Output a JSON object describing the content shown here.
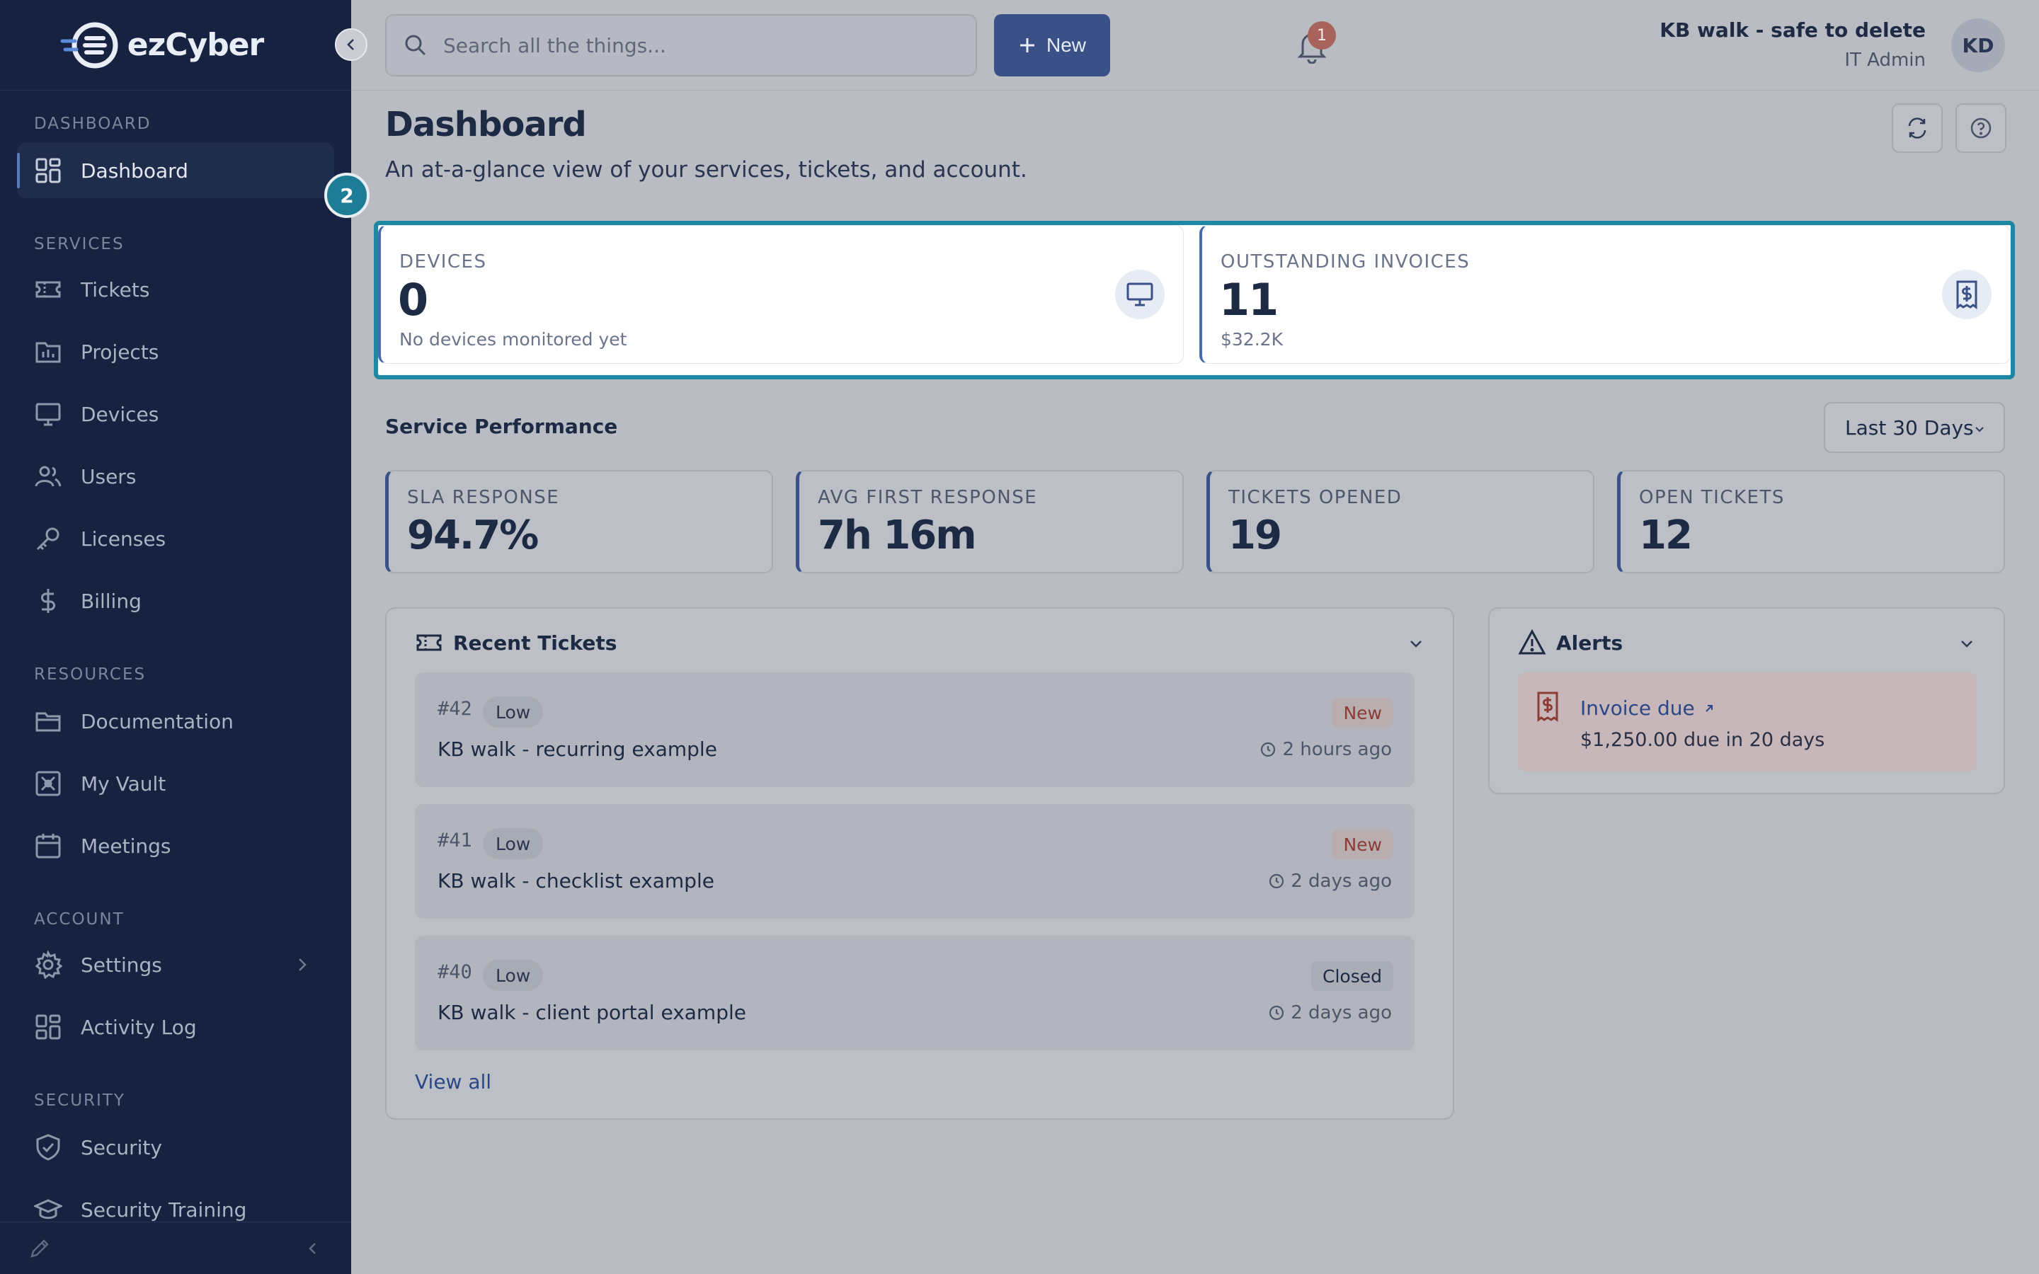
{
  "brand": {
    "logo_text": "ezCyber"
  },
  "sidebar": {
    "sections": [
      {
        "label": "DASHBOARD"
      },
      {
        "label": "SERVICES"
      },
      {
        "label": "RESOURCES"
      },
      {
        "label": "ACCOUNT"
      },
      {
        "label": "SECURITY"
      }
    ],
    "items": [
      {
        "label": "Dashboard",
        "icon": "dashboard-icon",
        "active": true
      },
      {
        "label": "Tickets",
        "icon": "ticket-icon"
      },
      {
        "label": "Projects",
        "icon": "projects-icon"
      },
      {
        "label": "Devices",
        "icon": "monitor-icon"
      },
      {
        "label": "Users",
        "icon": "users-icon"
      },
      {
        "label": "Licenses",
        "icon": "key-icon"
      },
      {
        "label": "Billing",
        "icon": "dollar-icon"
      },
      {
        "label": "Documentation",
        "icon": "folder-icon"
      },
      {
        "label": "My Vault",
        "icon": "vault-icon"
      },
      {
        "label": "Meetings",
        "icon": "calendar-icon"
      },
      {
        "label": "Settings",
        "icon": "gear-icon"
      },
      {
        "label": "Activity Log",
        "icon": "activity-icon"
      },
      {
        "label": "Security",
        "icon": "shield-icon"
      },
      {
        "label": "Security Training",
        "icon": "graduation-cap-icon"
      }
    ]
  },
  "topbar": {
    "search_placeholder": "Search all the things...",
    "new_label": "New",
    "notification_count": "1",
    "user_name": "KB walk - safe to delete",
    "user_role": "IT Admin",
    "avatar_initials": "KD"
  },
  "page": {
    "title": "Dashboard",
    "subtitle": "An at-a-glance view of your services, tickets, and account.",
    "step_badge": "2"
  },
  "kpis": [
    {
      "label": "DEVICES",
      "value": "0",
      "note": "No devices monitored yet",
      "icon": "monitor-icon"
    },
    {
      "label": "OUTSTANDING INVOICES",
      "value": "11",
      "note": "$32.2K",
      "icon": "invoice-icon"
    }
  ],
  "performance": {
    "title": "Service Performance",
    "range": "Last 30 Days",
    "metrics": [
      {
        "label": "SLA RESPONSE",
        "value": "94.7%"
      },
      {
        "label": "AVG FIRST RESPONSE",
        "value": "7h 16m"
      },
      {
        "label": "TICKETS OPENED",
        "value": "19"
      },
      {
        "label": "OPEN TICKETS",
        "value": "12"
      }
    ]
  },
  "recent_tickets": {
    "title": "Recent Tickets",
    "items": [
      {
        "number": "#42",
        "priority": "Low",
        "title": "KB walk - recurring example",
        "status": "New",
        "time": "2 hours ago"
      },
      {
        "number": "#41",
        "priority": "Low",
        "title": "KB walk - checklist example",
        "status": "New",
        "time": "2 days ago"
      },
      {
        "number": "#40",
        "priority": "Low",
        "title": "KB walk - client portal example",
        "status": "Closed",
        "time": "2 days ago"
      }
    ],
    "view_all": "View all"
  },
  "alerts": {
    "title": "Alerts",
    "items": [
      {
        "title": "Invoice due",
        "detail": "$1,250.00 due in 20 days"
      }
    ]
  },
  "colors": {
    "sidebar_bg": "#16223f",
    "accent": "#3a5188",
    "highlight": "#1e87a3",
    "status_new": "#8c3b35"
  }
}
